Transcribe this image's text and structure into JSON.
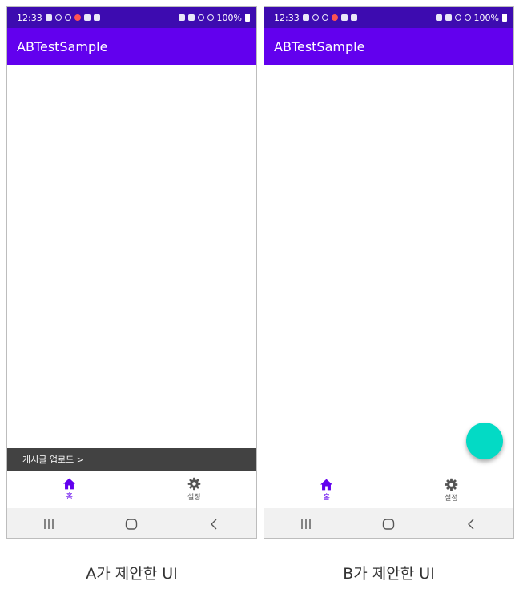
{
  "phones": [
    {
      "time": "12:33",
      "battery": "100%",
      "app_title": "ABTestSample",
      "snackbar_text": "게시글 업로드 >",
      "nav": [
        {
          "label": "홈",
          "icon": "home-icon",
          "active": true
        },
        {
          "label": "설정",
          "icon": "gear-icon",
          "active": false
        }
      ],
      "caption": "A가 제안한 UI"
    },
    {
      "time": "12:33",
      "battery": "100%",
      "app_title": "ABTestSample",
      "fab": {
        "color": "#03dac5"
      },
      "nav": [
        {
          "label": "홈",
          "icon": "home-icon",
          "active": true
        },
        {
          "label": "설정",
          "icon": "gear-icon",
          "active": false
        }
      ],
      "caption": "B가 제안한 UI"
    }
  ],
  "colors": {
    "status_bar": "#3d0bb0",
    "app_bar": "#6200ee",
    "accent": "#6200ee",
    "snackbar": "#424242",
    "fab": "#03dac5"
  }
}
